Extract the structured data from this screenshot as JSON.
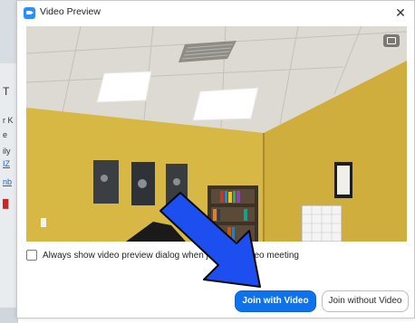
{
  "window": {
    "title": "Video Preview",
    "close_glyph": "✕"
  },
  "background_app": {
    "fragments": [
      "T",
      "r K",
      "e",
      "ily",
      "IZ",
      "nb"
    ]
  },
  "video": {
    "pip_icon": "picture-in-picture-icon"
  },
  "preview_option": {
    "label": "Always show video preview dialog when joining a video meeting",
    "checked": false
  },
  "buttons": {
    "join_with_video": "Join with Video",
    "join_without_video": "Join without Video"
  },
  "colors": {
    "primary": "#0e72ed",
    "arrow": "#1d4ff0",
    "wall": "#d8b845"
  }
}
